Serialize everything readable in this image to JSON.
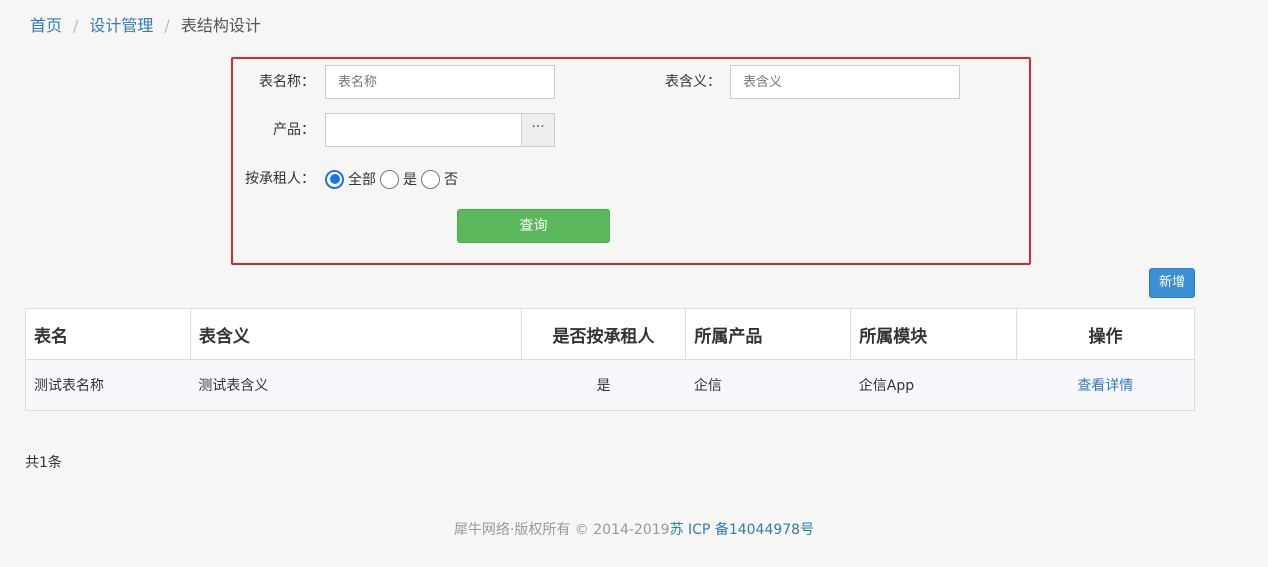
{
  "breadcrumb": {
    "home": "首页",
    "design": "设计管理",
    "current": "表结构设计",
    "separator": "/"
  },
  "search": {
    "table_name_label": "表名称：",
    "table_name_placeholder": "表名称",
    "table_meaning_label": "表含义：",
    "table_meaning_placeholder": "表含义",
    "product_label": "产品：",
    "product_value": "",
    "picker_label": "···",
    "tenant_label": "按承租人：",
    "tenant_options": [
      "全部",
      "是",
      "否"
    ],
    "tenant_selected": "全部",
    "query_button": "查询"
  },
  "toolbar": {
    "add_button": "新增"
  },
  "table": {
    "headers": [
      "表名",
      "表含义",
      "是否按承租人",
      "所属产品",
      "所属模块",
      "操作"
    ],
    "rows": [
      {
        "name": "测试表名称",
        "meaning": "测试表含义",
        "by_tenant": "是",
        "product": "企信",
        "module": "企信App",
        "action": "查看详情"
      }
    ]
  },
  "total": "共1条",
  "footer": {
    "copyright": "犀牛网络·版权所有 © 2014-2019",
    "icp": "苏 ICP 备14044978号"
  },
  "colors": {
    "accent": "#337ab7",
    "query_button": "#5cb85c",
    "add_button": "#3b8fd6",
    "highlight_border": "#e3262c"
  }
}
